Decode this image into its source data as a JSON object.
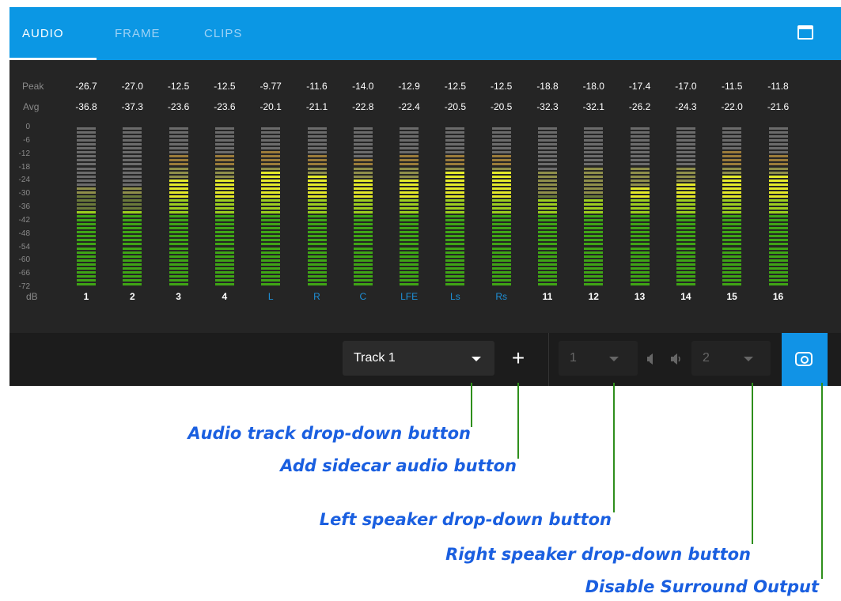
{
  "tabs": [
    {
      "label": "AUDIO",
      "active": true
    },
    {
      "label": "FRAME",
      "active": false
    },
    {
      "label": "CLIPS",
      "active": false
    }
  ],
  "popout_icon": "popout-window-icon",
  "meters": {
    "row_labels": {
      "peak": "Peak",
      "avg": "Avg",
      "db": "dB"
    },
    "scale": [
      "0",
      "-6",
      "-12",
      "-18",
      "-24",
      "-30",
      "-36",
      "-42",
      "-48",
      "-54",
      "-60",
      "-66",
      "-72"
    ],
    "channels": [
      {
        "name": "1",
        "peak": "-26.7",
        "avg": "-36.8",
        "surround": false
      },
      {
        "name": "2",
        "peak": "-27.0",
        "avg": "-37.3",
        "surround": false
      },
      {
        "name": "3",
        "peak": "-12.5",
        "avg": "-23.6",
        "surround": false
      },
      {
        "name": "4",
        "peak": "-12.5",
        "avg": "-23.6",
        "surround": false
      },
      {
        "name": "L",
        "peak": "-9.77",
        "avg": "-20.1",
        "surround": true
      },
      {
        "name": "R",
        "peak": "-11.6",
        "avg": "-21.1",
        "surround": true
      },
      {
        "name": "C",
        "peak": "-14.0",
        "avg": "-22.8",
        "surround": true
      },
      {
        "name": "LFE",
        "peak": "-12.9",
        "avg": "-22.4",
        "surround": true
      },
      {
        "name": "Ls",
        "peak": "-12.5",
        "avg": "-20.5",
        "surround": true
      },
      {
        "name": "Rs",
        "peak": "-12.5",
        "avg": "-20.5",
        "surround": true
      },
      {
        "name": "11",
        "peak": "-18.8",
        "avg": "-32.3",
        "surround": false
      },
      {
        "name": "12",
        "peak": "-18.0",
        "avg": "-32.1",
        "surround": false
      },
      {
        "name": "13",
        "peak": "-17.4",
        "avg": "-26.2",
        "surround": false
      },
      {
        "name": "14",
        "peak": "-17.0",
        "avg": "-24.3",
        "surround": false
      },
      {
        "name": "15",
        "peak": "-11.5",
        "avg": "-22.0",
        "surround": false
      },
      {
        "name": "16",
        "peak": "-11.8",
        "avg": "-21.6",
        "surround": false
      }
    ]
  },
  "controls": {
    "track_select": {
      "value": "Track 1"
    },
    "add_label": "+",
    "left_speaker": {
      "value": "1"
    },
    "right_speaker": {
      "value": "2"
    }
  },
  "colors": {
    "tab_bar": "#0b97e4",
    "panel": "#252525",
    "green": "#3fa515",
    "yellow": "#e3e92a",
    "callout_text": "#1a5fe0",
    "callout_line": "#2f8f1c"
  },
  "callouts": [
    {
      "text": "Audio track drop-down button"
    },
    {
      "text": "Add sidecar audio button"
    },
    {
      "text": "Left speaker drop-down button"
    },
    {
      "text": "Right speaker drop-down button"
    },
    {
      "text": "Disable Surround Output"
    }
  ]
}
